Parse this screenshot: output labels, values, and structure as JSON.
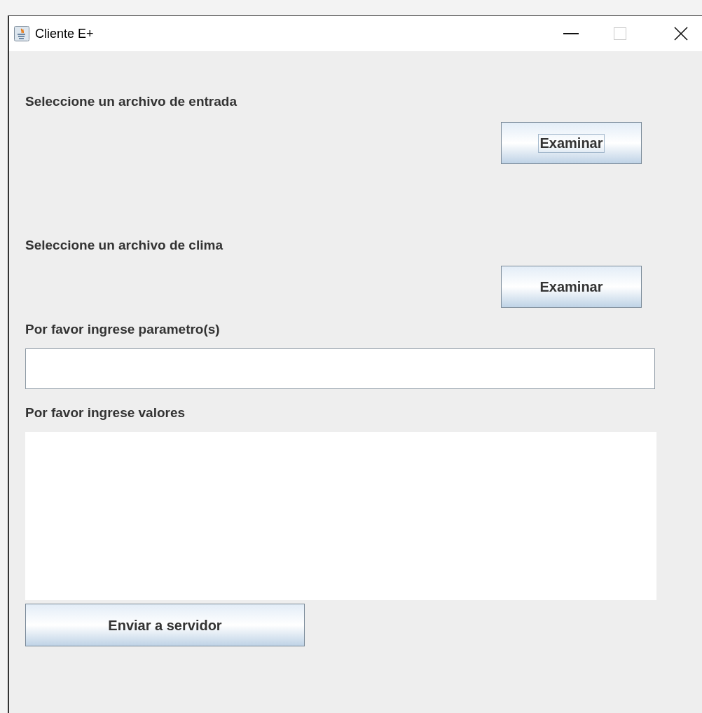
{
  "window": {
    "title": "Cliente E+"
  },
  "sections": [
    {
      "kind": "file",
      "label": "Seleccione un archivo de entrada",
      "button": {
        "label": "Examinar",
        "focused": true
      }
    },
    {
      "kind": "file",
      "label": "Seleccione un archivo de clima",
      "button": {
        "label": "Examinar",
        "focused": false
      }
    },
    {
      "kind": "field",
      "label": "Por favor ingrese parametro(s)"
    },
    {
      "kind": "area",
      "label": "Por favor ingrese valores"
    }
  ],
  "submit_button": {
    "label": "Enviar a servidor"
  }
}
